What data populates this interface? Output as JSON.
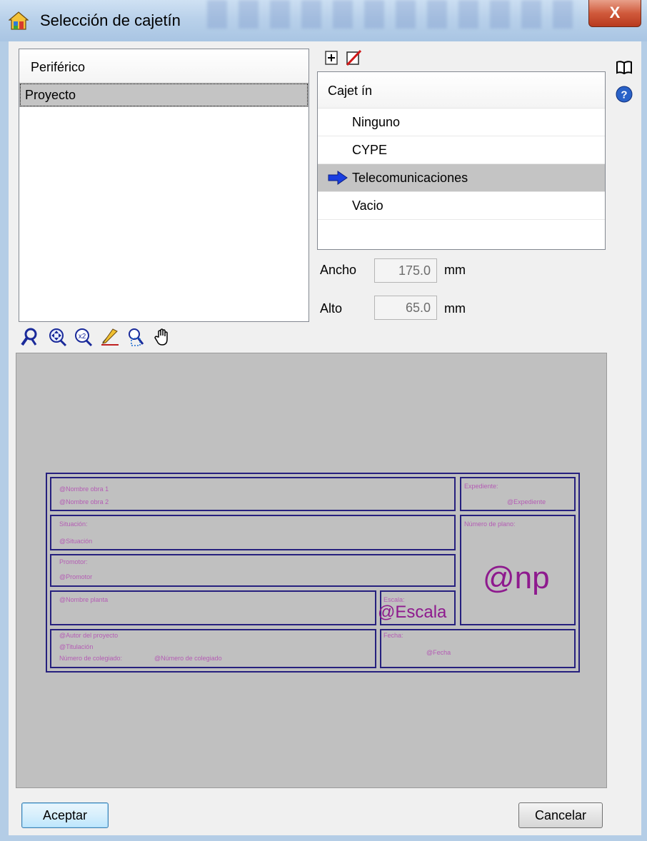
{
  "window": {
    "title": "Selección de cajetín",
    "close_label": "X"
  },
  "left_list": {
    "header": "Periférico",
    "items": [
      "Proyecto"
    ],
    "selected_index": 0
  },
  "right_list": {
    "header": "Cajet ín",
    "items": [
      "Ninguno",
      "CYPE",
      "Telecomunicaciones",
      "Vacio"
    ],
    "selected_index": 2
  },
  "dimensions": {
    "width_label": "Ancho",
    "width_value": "175.0",
    "height_label": "Alto",
    "height_value": "65.0",
    "unit": "mm"
  },
  "zoom_toolbar": {
    "icons": [
      "zoom-window-icon",
      "zoom-all-icon",
      "zoom-x2-icon",
      "measure-pen-icon",
      "zoom-select-icon",
      "pan-hand-icon"
    ]
  },
  "title_block": {
    "obra_1": "@Nombre obra 1",
    "obra_2": "@Nombre obra 2",
    "expediente_label": "Expediente:",
    "expediente_value": "@Expediente",
    "situacion_label": "Situación:",
    "situacion_value": "@Situación",
    "numero_plano_label": "Número de plano:",
    "promotor_label": "Promotor:",
    "promotor_value": "@Promotor",
    "np_value": "@np",
    "nombre_planta": "@Nombre planta",
    "escala_label": "Escala:",
    "escala_value": "@Escala",
    "autor": "@Autor del proyecto",
    "titulacion": "@Titulación",
    "numero_colegiado_label": "Número de colegiado:",
    "numero_colegiado_value": "@Número de colegiado",
    "fecha_label": "Fecha:",
    "fecha_value": "@Fecha"
  },
  "buttons": {
    "accept": "Aceptar",
    "cancel": "Cancelar"
  },
  "colors": {
    "title_block_border": "#26207e",
    "title_block_text": "#b45cb4",
    "preview_background": "#c0c0c0",
    "selection": "#c4c4c4"
  }
}
